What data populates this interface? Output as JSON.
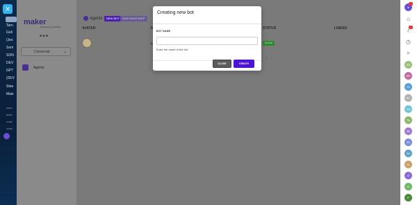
{
  "left_nav": {
    "items": [
      "Tarn",
      "Goli",
      "(Jes",
      "Som",
      "SON",
      "DEV",
      "GPT",
      "(DEV",
      "Stee",
      "Mais"
    ],
    "section_labels": [
      "AGEN",
      "BARR",
      "CURR",
      "CURR"
    ]
  },
  "sidebar": {
    "logo": "maker",
    "logo_sub": "Powered by CHATBot",
    "flags": "■ ■ ■",
    "org_select": "Comercial",
    "nav_agents": "Agents"
  },
  "main": {
    "title": "Agents",
    "new_bot_label": "NEW BOT",
    "new_whatsapp_label": "NEW WHATSAPP",
    "columns": [
      "AVATAR",
      "N",
      "STATUS",
      "LINKED"
    ],
    "row": {
      "name_initial": "M",
      "status": "ACTIVE"
    }
  },
  "modal": {
    "title": "Creating new bot",
    "field_label": "BOT NAME",
    "field_value": "",
    "field_placeholder": "",
    "help_text": "Enter the name of the bot.",
    "close_label": "CLOSE",
    "create_label": "CREATE"
  },
  "right_rail": {
    "avatars": [
      "EA",
      "BR",
      "YZ",
      "RO",
      "CA",
      "TA",
      "SE",
      "FO",
      "DK",
      "GL",
      "S",
      "G",
      "P"
    ],
    "avatar_colors": [
      "#9ac17a",
      "#c46aa0",
      "#5aa0d8",
      "#b0b0b0",
      "#6fc7d6",
      "#8fb86a",
      "#9f7ad0",
      "#7a8fd6",
      "#5fa0c8",
      "#c8a06a",
      "#8a6bd8",
      "#6fb86a",
      "#4b8a3a"
    ]
  },
  "colors": {
    "primary": "#4e14d6",
    "close": "#5c5c5c",
    "active": "#2f8a2f"
  }
}
